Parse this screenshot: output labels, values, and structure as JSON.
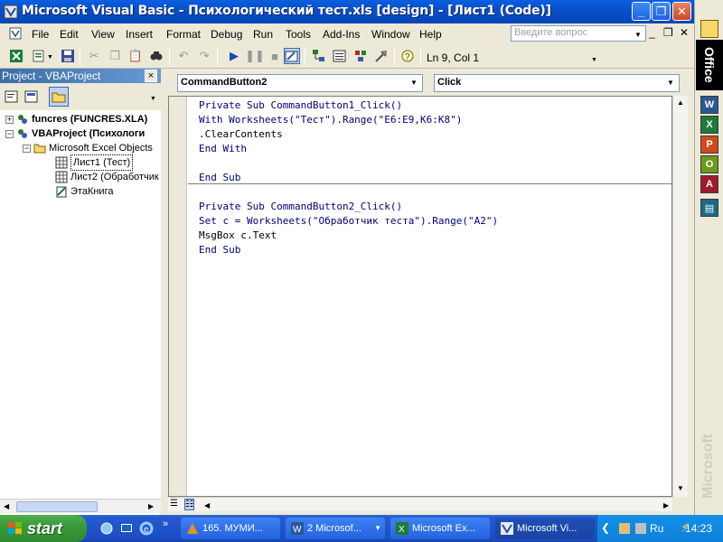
{
  "window": {
    "title": "Microsoft Visual Basic - Психологический тест.xls [design] - [Лист1 (Code)]",
    "minimize": "_",
    "restore": "❐",
    "close": "✕"
  },
  "menu": {
    "items": [
      "File",
      "Edit",
      "View",
      "Insert",
      "Format",
      "Debug",
      "Run",
      "Tools",
      "Add-Ins",
      "Window",
      "Help"
    ],
    "ask_placeholder": "Введите вопрос",
    "mdi_min": "_",
    "mdi_restore": "❐",
    "mdi_close": "✕"
  },
  "toolbar": {
    "position": "Ln 9, Col 1"
  },
  "project": {
    "title": "Project - VBAProject",
    "close": "×",
    "tree": [
      {
        "label": "funcres (FUNCRES.XLA)",
        "expander": "+",
        "bold": true
      },
      {
        "label": "VBAProject (Психологи",
        "expander": "−",
        "bold": true
      },
      {
        "label": "Microsoft Excel Objects",
        "expander": "−",
        "bold": false
      },
      {
        "label": "Лист1 (Тест)",
        "expander": "",
        "bold": false
      },
      {
        "label": "Лист2 (Обработчик",
        "expander": "",
        "bold": false
      },
      {
        "label": "ЭтаКнига",
        "expander": "",
        "bold": false
      }
    ]
  },
  "code": {
    "object": "CommandButton2",
    "procedure": "Click",
    "proc1": [
      "Private Sub CommandButton1_Click()",
      "With Worksheets(\"Тест\").Range(\"E6:E9,K6:K8\")",
      ".ClearContents",
      "End With",
      "",
      "End Sub"
    ],
    "proc2": [
      "Private Sub CommandButton2_Click()",
      "Set c = Worksheets(\"Обработчик теста\").Range(\"A2\")",
      "MsgBox c.Text",
      "End Sub"
    ]
  },
  "officebar": {
    "logo": "Office",
    "watermark": "Microsoft"
  },
  "taskbar": {
    "start": "start",
    "tasks": [
      "165. МУМИ...",
      "2 Microsof...",
      "Microsoft Ex...",
      "Microsoft Vi..."
    ],
    "lang": "Ru",
    "clock": "14:23"
  },
  "colors": {
    "title_blue": "#0a5fe0",
    "keyword_blue": "#00007f",
    "start_green": "#3a9a3a"
  }
}
